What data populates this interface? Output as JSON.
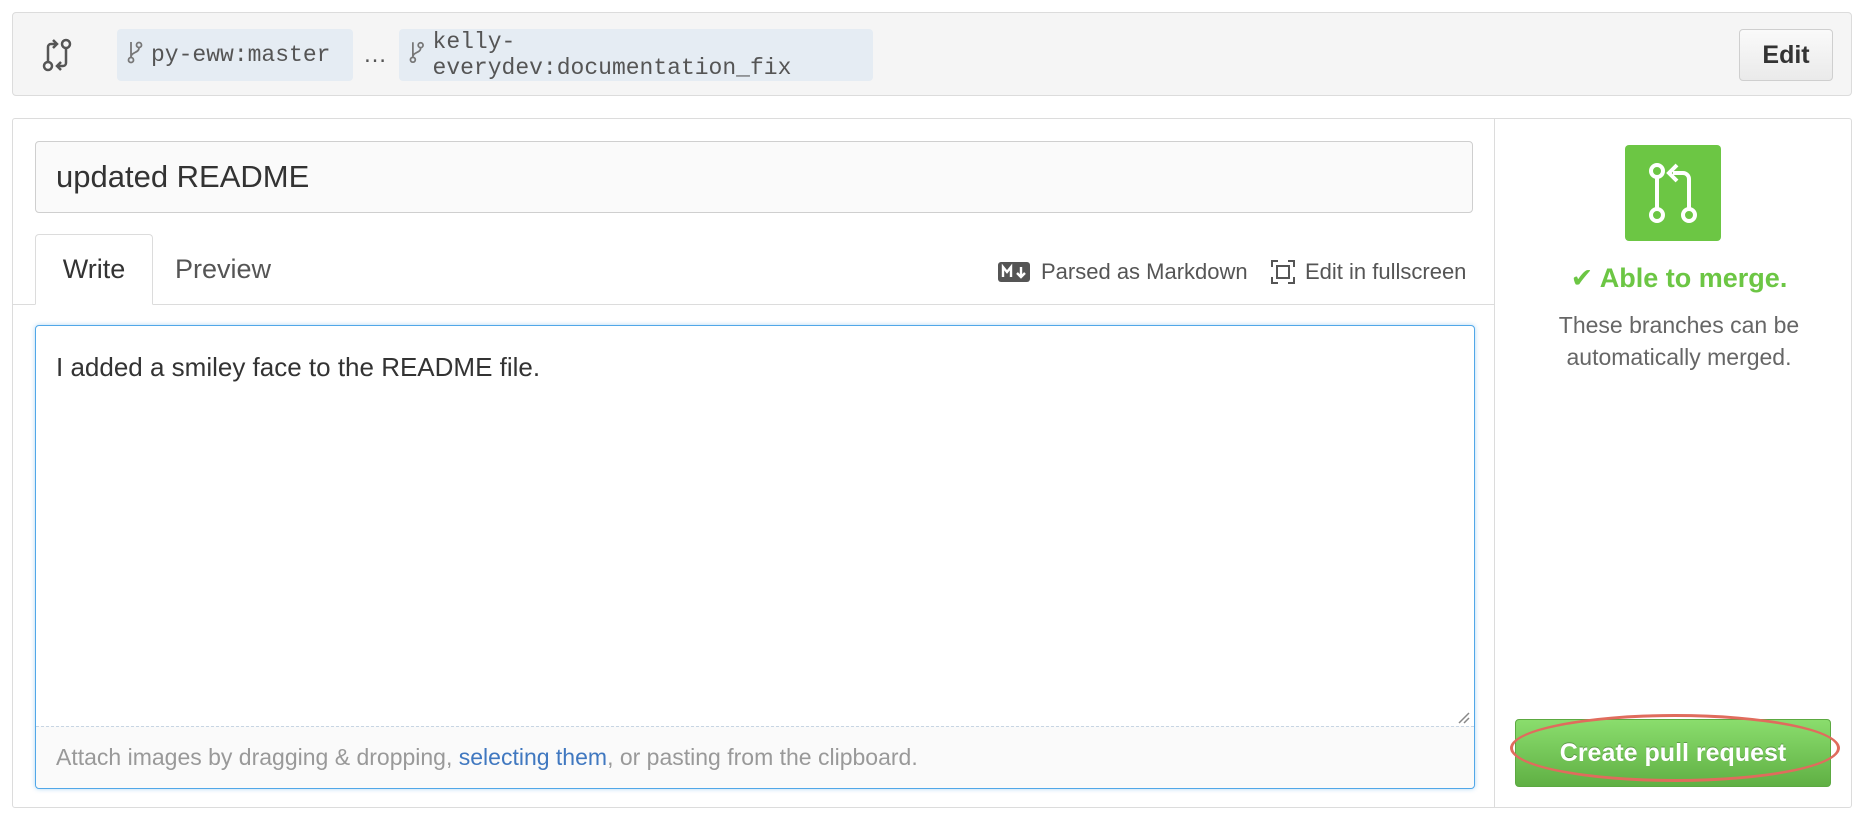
{
  "compare": {
    "icon": "git-compare-icon",
    "base_branch": "py-eww:master",
    "separator": "…",
    "head_branch": "kelly-everydev:documentation_fix",
    "edit_label": "Edit"
  },
  "pull_request": {
    "title_value": "updated README",
    "tabs": [
      {
        "label": "Write",
        "active": true
      },
      {
        "label": "Preview",
        "active": false
      }
    ],
    "toolbar": {
      "markdown_label": "Parsed as Markdown",
      "fullscreen_label": "Edit in fullscreen"
    },
    "comment_value": "I added a smiley face to the README file.",
    "attach": {
      "prefix": "Attach images by dragging & dropping, ",
      "link": "selecting them",
      "suffix": ", or pasting from the clipboard."
    }
  },
  "sidebar": {
    "icon": "git-pull-request-icon",
    "status": "✔ Able to merge.",
    "description": "These branches can be automatically merged.",
    "create_label": "Create pull request"
  },
  "colors": {
    "accent_green": "#6cc644",
    "link_blue": "#4078c0",
    "highlight_red": "#e06c5d",
    "focus_blue": "#51a7e8"
  }
}
